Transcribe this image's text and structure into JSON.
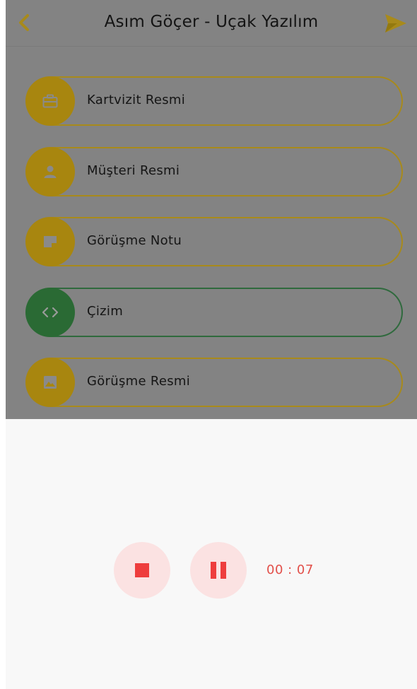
{
  "header": {
    "title": "Asım Göçer - Uçak Yazılım",
    "back_icon": "chevron-left-icon",
    "send_icon": "send-icon"
  },
  "menu": {
    "items": [
      {
        "label": "Kartvizit Resmi",
        "icon": "briefcase-icon",
        "color": "#a8860f"
      },
      {
        "label": "Müşteri Resmi",
        "icon": "person-icon",
        "color": "#a8860f"
      },
      {
        "label": "Görüşme Notu",
        "icon": "note-icon",
        "color": "#a8860f"
      },
      {
        "label": "Çizim",
        "icon": "code-icon",
        "color": "#2a6a34"
      },
      {
        "label": "Görüşme Resmi",
        "icon": "image-icon",
        "color": "#a8860f"
      }
    ]
  },
  "recorder": {
    "stop_icon": "stop-icon",
    "pause_icon": "pause-icon",
    "timer": "00 : 07",
    "accent_color": "#ee3d3d"
  },
  "colors": {
    "brand_yellow": "#f2c01e",
    "brand_green": "#3d9a4c",
    "overlay": "#838383"
  }
}
